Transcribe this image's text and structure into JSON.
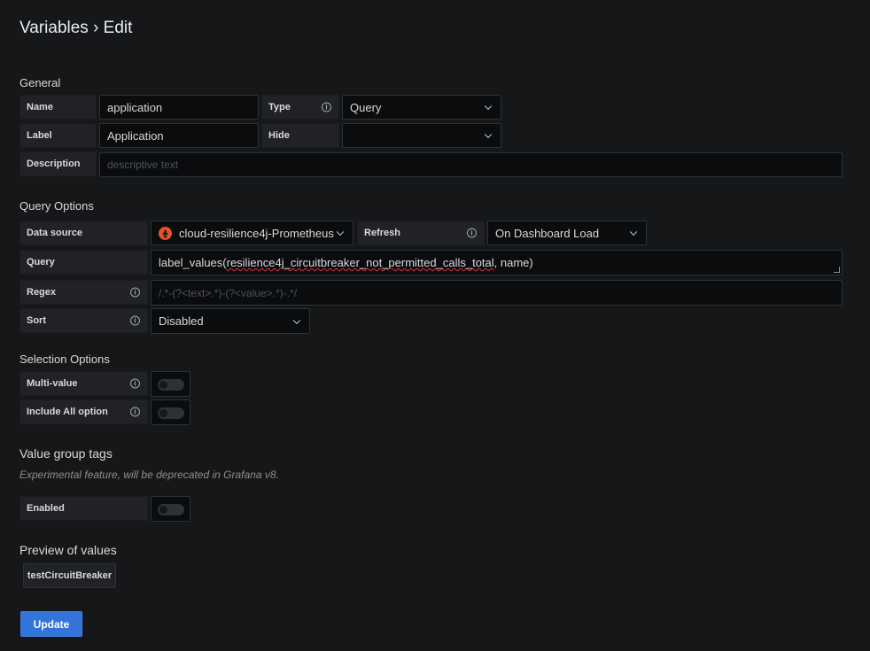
{
  "page": {
    "title": "Variables › Edit"
  },
  "general": {
    "section_title": "General",
    "name_label": "Name",
    "name_value": "application",
    "type_label": "Type",
    "type_value": "Query",
    "label_label": "Label",
    "label_value": "Application",
    "hide_label": "Hide",
    "hide_value": "",
    "description_label": "Description",
    "description_placeholder": "descriptive text"
  },
  "query_options": {
    "section_title": "Query Options",
    "datasource_label": "Data source",
    "datasource_value": "cloud-resilience4j-Prometheus",
    "refresh_label": "Refresh",
    "refresh_value": "On Dashboard Load",
    "query_label": "Query",
    "query_prefix": "label_values(",
    "query_metric": "resilience4j_circuitbreaker_not_permitted_calls_total",
    "query_suffix": ", name)",
    "regex_label": "Regex",
    "regex_placeholder": "/.*-(?<text>.*)-(?<value>.*)-.*/",
    "sort_label": "Sort",
    "sort_value": "Disabled"
  },
  "selection_options": {
    "section_title": "Selection Options",
    "multi_value_label": "Multi-value",
    "multi_value_enabled": false,
    "include_all_label": "Include All option",
    "include_all_enabled": false
  },
  "value_group_tags": {
    "section_title": "Value group tags",
    "note": "Experimental feature, will be deprecated in Grafana v8.",
    "enabled_label": "Enabled",
    "enabled": false
  },
  "preview": {
    "section_title": "Preview of values",
    "values": [
      "testCircuitBreaker"
    ]
  },
  "actions": {
    "update_label": "Update"
  },
  "colors": {
    "background": "#161719",
    "primary": "#3274d9",
    "prometheus": "#e6522c"
  },
  "icons": {
    "info": "info-circle-icon",
    "chevron": "chevron-down-icon",
    "datasource": "prometheus-logo-icon"
  }
}
